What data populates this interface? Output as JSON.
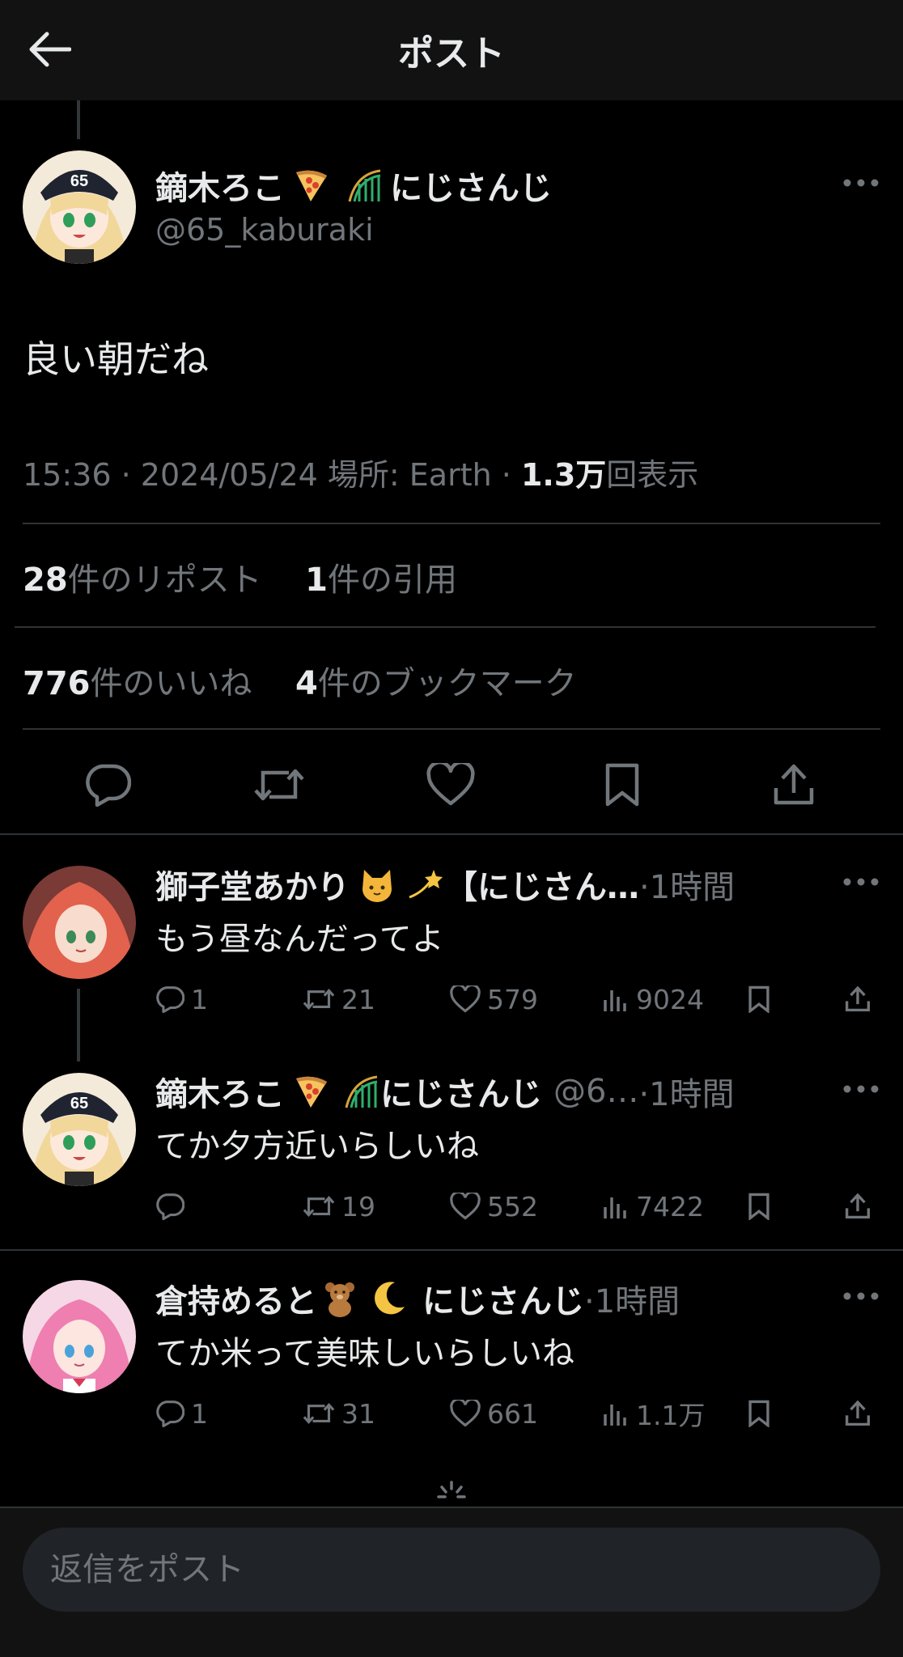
{
  "header": {
    "title": "ポスト"
  },
  "post": {
    "author_name": "鏑木ろこ",
    "author_suffix": "にじさんじ",
    "author_handle": "@65_kaburaki",
    "text": "良い朝だね",
    "time": "15:36",
    "date": "2024/05/24",
    "location_label": "場所: Earth",
    "views_count": "1.3万",
    "views_label": "回表示",
    "reposts_count": "28",
    "reposts_label": "件のリポスト",
    "quotes_count": "1",
    "quotes_label": "件の引用",
    "likes_count": "776",
    "likes_label": "件のいいね",
    "bookmarks_count": "4",
    "bookmarks_label": "件のブックマーク"
  },
  "replies": [
    {
      "name": "獅子堂あかり",
      "name_tail": "【にじさん…",
      "time": "·1時間",
      "text": "もう昼なんだってよ",
      "replies": "1",
      "reposts": "21",
      "likes": "579",
      "views": "9024"
    },
    {
      "name": "鏑木ろこ",
      "name_tail": "にじさんじ",
      "handle": "@6…",
      "time": "·1時間",
      "text": "てか夕方近いらしいね",
      "replies": "",
      "reposts": "19",
      "likes": "552",
      "views": "7422"
    },
    {
      "name": "倉持めると",
      "name_tail": "にじさんじ",
      "time": "·1時間",
      "text": "てか米って美味しいらしいね",
      "replies": "1",
      "reposts": "31",
      "likes": "661",
      "views": "1.1万"
    }
  ],
  "reply_box": {
    "placeholder": "返信をポスト"
  },
  "colors": {
    "background": "#000000",
    "text": "#e7e9ea",
    "muted": "#71767b",
    "divider": "#2f3336"
  }
}
